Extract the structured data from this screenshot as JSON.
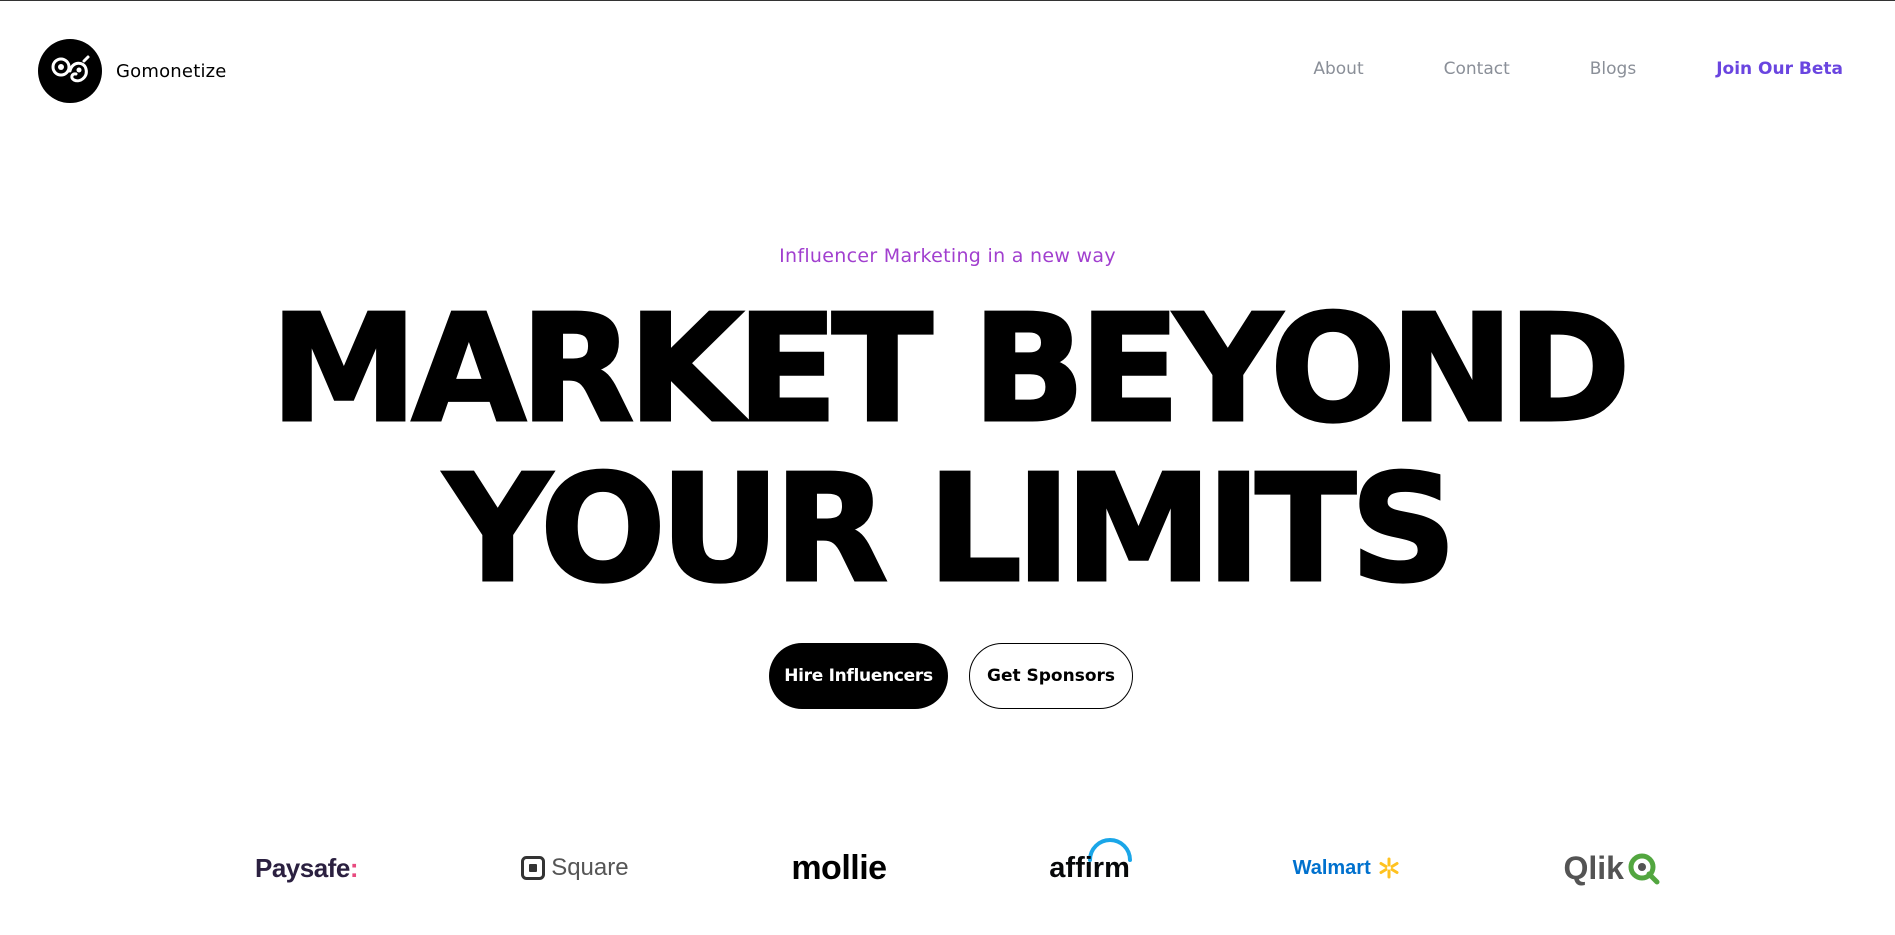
{
  "header": {
    "brand_name": "Gomonetize",
    "nav": {
      "about": "About",
      "contact": "Contact",
      "blogs": "Blogs",
      "join_beta": "Join Our Beta"
    }
  },
  "hero": {
    "tagline": "Influencer Marketing in a new way",
    "headline_line1": "MARKET BEYOND",
    "headline_line2": "YOUR LIMITS",
    "primary_button": "Hire Influencers",
    "secondary_button": "Get Sponsors"
  },
  "partners": {
    "paysafe": "Paysafe",
    "paysafe_mark": ":",
    "square": "Square",
    "mollie": "mollie",
    "affirm": "affirm",
    "walmart": "Walmart",
    "qlik": "Qlik"
  },
  "colors": {
    "tagline": "#a13fcf",
    "nav_link": "#8a8f98",
    "nav_cta": "#6a45e0",
    "affirm_arc": "#1aa6e8",
    "walmart_blue": "#0071ce",
    "walmart_spark": "#ffc220",
    "qlik_green": "#52a63f",
    "paysafe_accent": "#e84a7f"
  }
}
